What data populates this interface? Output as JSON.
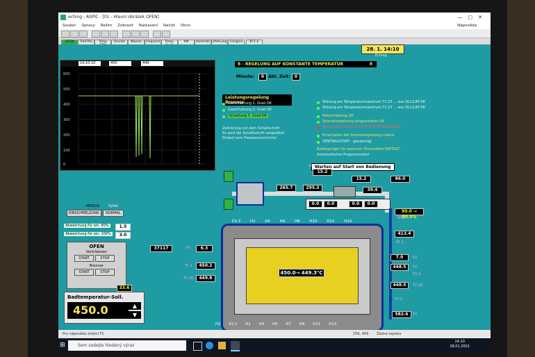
{
  "window": {
    "title": "eching - ASPIC - [01 - Hlavní obrázek OFEN]"
  },
  "menu": {
    "items": [
      "Soubor",
      "Úpravy",
      "Režim",
      "Zobrazit",
      "Nastavení",
      "Načíst",
      "Okno"
    ],
    "help": "Nápověda"
  },
  "tabs": [
    "OFEN",
    "TreeTAG",
    "Temp STN",
    "Drucke",
    "Wasser",
    "Frequenz",
    "Temp-Ausz",
    "RM",
    "KarlenID",
    "ZAHLung",
    "Ereignis",
    "BT1-E"
  ],
  "active_tab": "OFEN",
  "header": {
    "datetime": "28. 1. 14:10",
    "site": "Eching"
  },
  "chart": {
    "tag1": "14:10:10",
    "tag2": "450",
    "tag3": "449",
    "yticks": [
      "600",
      "500",
      "400",
      "300",
      "200",
      "100",
      "0"
    ]
  },
  "regulation": {
    "title": "8 - REGELUNG AUF KONSTANTE TEMPERATUR",
    "value": "8",
    "minute_label": "Minute:",
    "minute": "0",
    "akt_label": "Akt. Zeit:",
    "akt": "0"
  },
  "burner": {
    "title": "Leistungsregelung Brenner",
    "lines": [
      "Gasschaltung 1. Grad OK",
      "Gasschaltung 2. Grad OK",
      "Schaltung 3. Grad OK"
    ],
    "note": [
      "Zeitverzug vor dem Schaltschritt",
      "Es wird der Schaltschritt eingeleitet",
      "Einlauf vom Frequenzumrichter"
    ]
  },
  "alarms": {
    "lines": [
      "Störung am Temperaturmaximum T1.10 ... aus OLC/LIM OK",
      "Störung am Temperaturmaximum T2.10 ... aus OLC/LIM OK",
      "Netzschaltung OK",
      "Stromeinspeisung eingeschaltet OK",
      "Temperaturmessung im STATISTIK abschalten",
      "Einschalten der Stromeinspeisung inaktiv",
      "ZENTRALSTOPP - genehmigt",
      "Bedingungen für automat. Einschalten ERFÜLLT",
      "Automatischer Programmstart"
    ]
  },
  "wait_banner": "Warten auf Start von Bedienung",
  "values": {
    "t1_top": "15.2",
    "t2_top": "15.2",
    "vt2": "86.0",
    "t26": "39.4",
    "tl": "265.7",
    "tc": "295.3",
    "row_a": "0.0",
    "row_b": "0.0",
    "row_c": "0.0",
    "row_d": "0.0",
    "pct": "90.0 → 90.5%",
    "p_right": "413.4",
    "p1a": "37117",
    "p1b": "6.3",
    "p2": "7.0",
    "t1": "450.2",
    "t1b": "449.8",
    "t2": "448.5",
    "t2b": "448.5",
    "t7": "582.6",
    "oven_temp": "450.0→ 449.3℃",
    "fan_val": "33.6"
  },
  "oven_labels_top": [
    "P2.3",
    "H2",
    "H4",
    "H6",
    "H8",
    "H10",
    "H12",
    "H14"
  ],
  "oven_labels_bot": [
    "H2",
    "P2.1",
    "H1",
    "H3",
    "H5",
    "H7",
    "H9",
    "H11",
    "H13"
  ],
  "sensor_labels": {
    "vt1": "VT1",
    "sm1": "SM1",
    "p1_1": "P1.1",
    "p2_1": "P2.1",
    "t1_1": "T1.1",
    "t1_1b": "T1.1R",
    "t2_2": "T2.2",
    "t2_1r": "T2.1R",
    "t7": "T7",
    "p1": "P1",
    "p2": "P2",
    "t2": "T2"
  },
  "modus": {
    "label": "MODUS",
    "vyber": "Výběr",
    "btn1": "EINSCHMELZUNG",
    "btn2": "NORMAL"
  },
  "deviation": {
    "l1": "Abweichung für ein. 80%",
    "v1": "1.5",
    "l2": "Abweichung für ein. 100%",
    "v2": "3.0"
  },
  "ofen": {
    "title": "OFEN",
    "sub": "Ventilatoren",
    "start": "START",
    "stop": "STOP",
    "brenner": "Brenner",
    "bstart": "START",
    "bstop": "STOP"
  },
  "setpoint": {
    "label": "Badtemperatur-Soll.",
    "value": "450.0"
  },
  "status": {
    "left": "Pro nápovědu stiskni F1",
    "coords": "256, 409",
    "mode": "Žádná teplota"
  },
  "taskbar": {
    "search": "Sem zadejte hledaný výraz",
    "time": "14:10",
    "date": "28.01.2021"
  }
}
